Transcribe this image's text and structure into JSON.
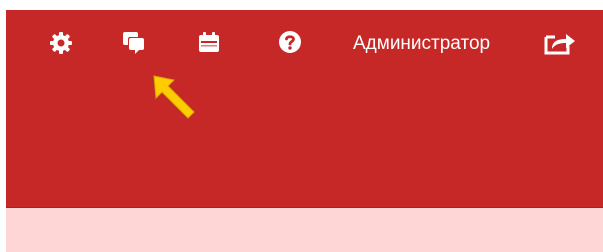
{
  "header": {
    "background_color": "#c62828",
    "icon_color": "#ffffff",
    "toolbar": [
      {
        "name": "settings",
        "icon": "gear-icon"
      },
      {
        "name": "messages",
        "icon": "chat-bubbles-icon"
      },
      {
        "name": "calendar",
        "icon": "calendar-icon"
      },
      {
        "name": "help",
        "icon": "question-circle-icon"
      }
    ],
    "user_name": "Администратор",
    "logout_icon": "logout-share-icon"
  },
  "content": {
    "background_color": "#ffd6d6"
  },
  "annotation": {
    "pointer_color": "#ffcc00",
    "pointer_icon": "yellow-arrow-pointer"
  }
}
